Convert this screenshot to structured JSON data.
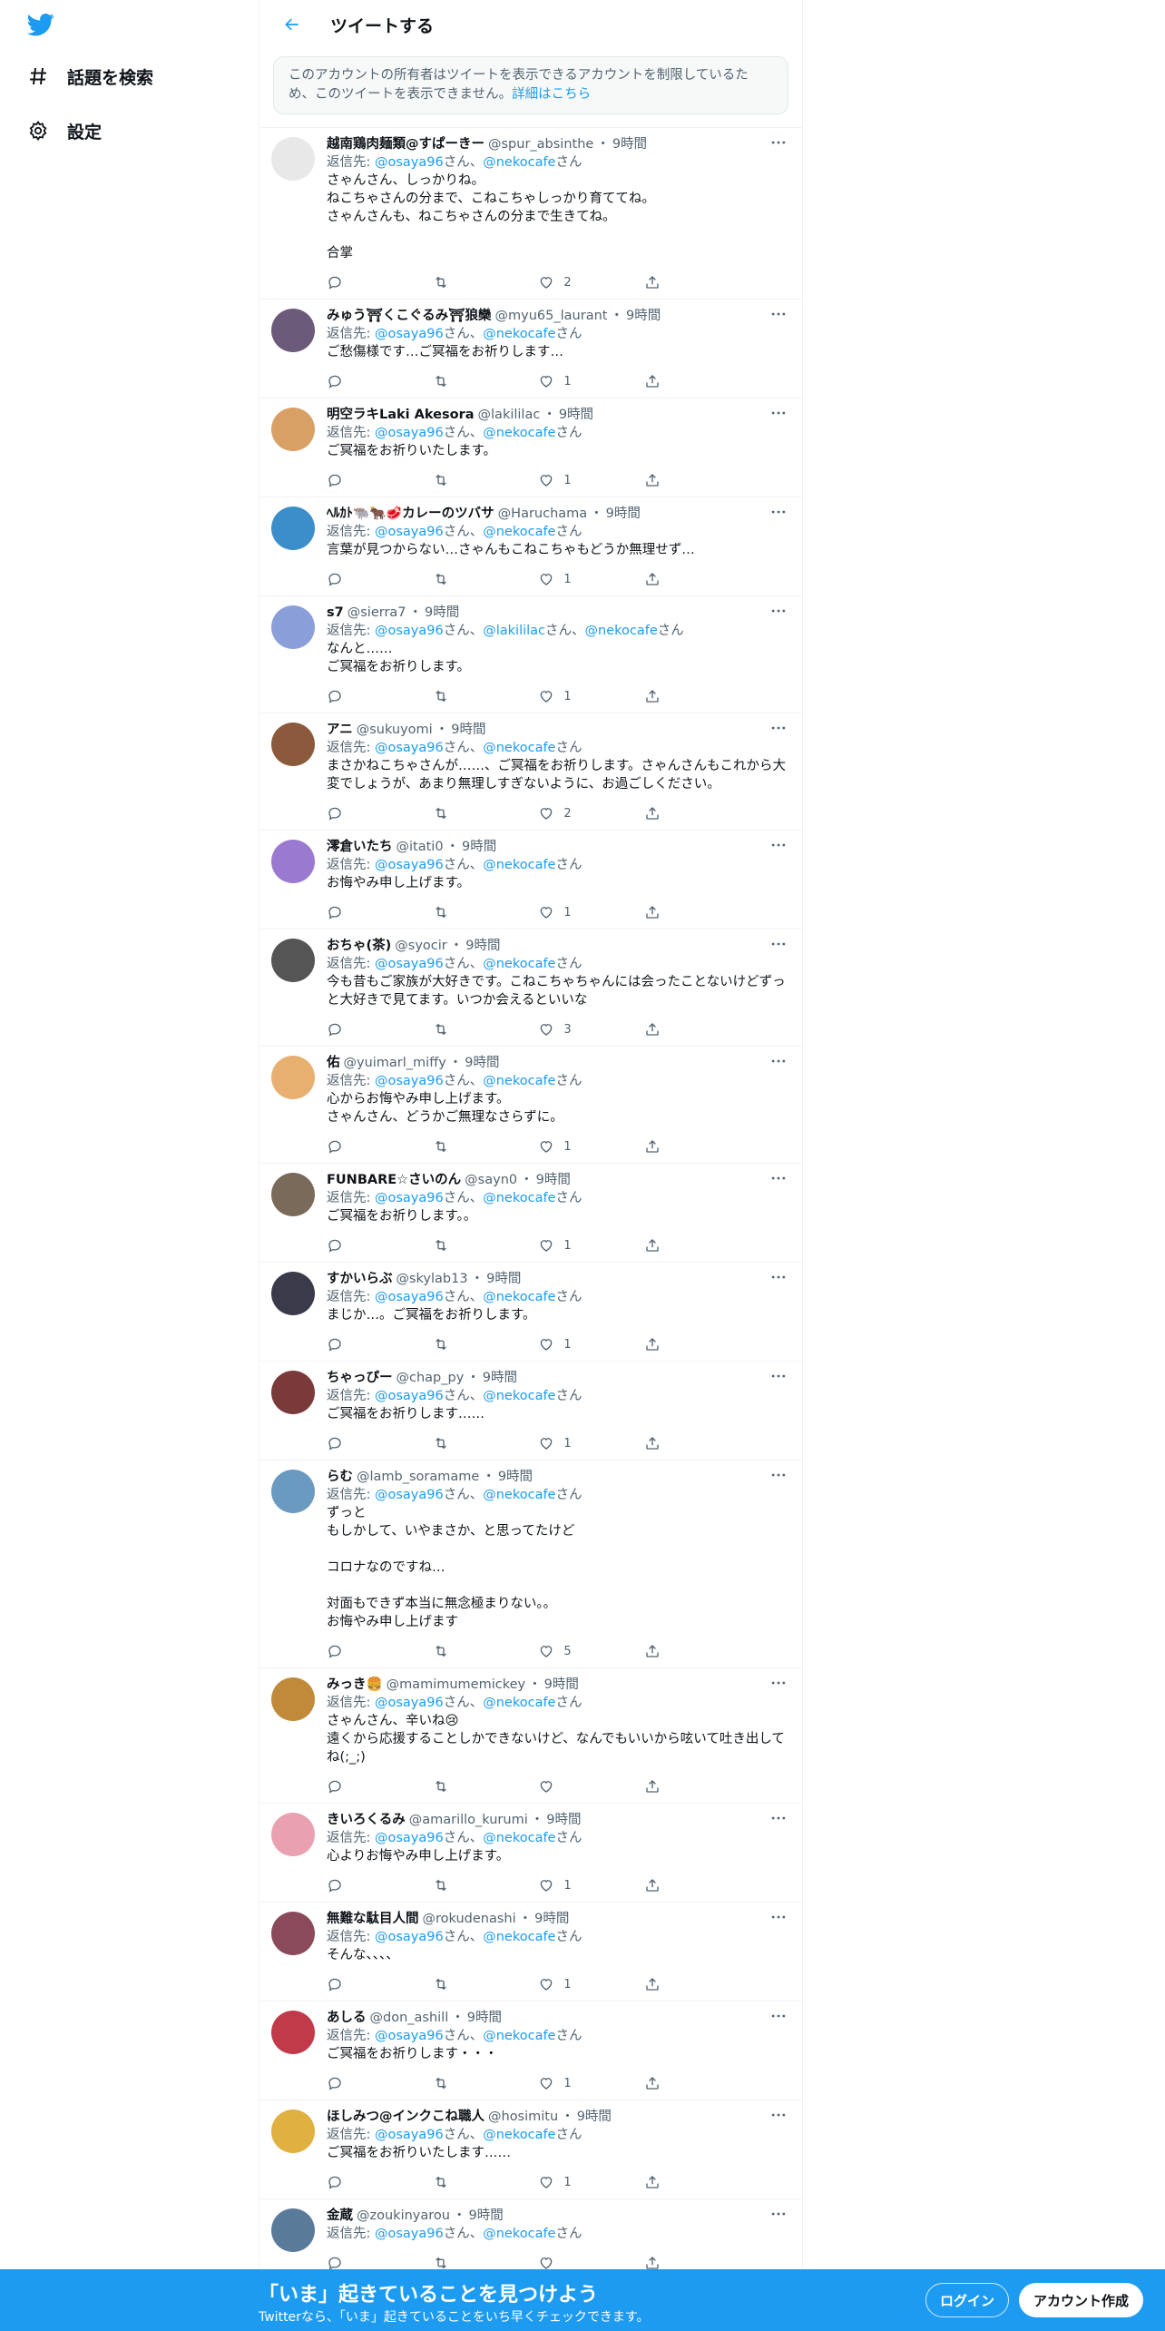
{
  "sidebar": {
    "logo_name": "twitter-logo",
    "items": [
      {
        "label": "話題を検索",
        "icon": "hashtag-icon"
      },
      {
        "label": "設定",
        "icon": "gear-icon"
      }
    ]
  },
  "header": {
    "title": "ツイートする"
  },
  "notice": {
    "text": "このアカウントの所有者はツイートを表示できるアカウントを制限しているため、このツイートを表示できません。",
    "link": "詳細はこちら"
  },
  "labels": {
    "reply_prefix": "返信先: ",
    "san": "さん",
    "sep": "、",
    "dot": "・"
  },
  "colors": {
    "accent": "#1d9bf0",
    "text": "#0f1419",
    "secondary": "#536471"
  },
  "tweets": [
    {
      "name": "越南鶏肉麺類@すぱーきー",
      "handle": "@spur_absinthe",
      "time": "9時間",
      "reply_to": [
        "@osaya96",
        "@nekocafe"
      ],
      "text": "さゃんさん、しっかりね。\nねこちゃさんの分まで、こねこちゃしっかり育ててね。\nさゃんさんも、ねこちゃさんの分まで生きてね。\n\n合掌",
      "likes": "2",
      "avatar_color": "#e8e8e8"
    },
    {
      "name": "みゅう⛩くこぐるみ⛩狼欒",
      "handle": "@myu65_laurant",
      "time": "9時間",
      "reply_to": [
        "@osaya96",
        "@nekocafe"
      ],
      "text": "ご愁傷様です…ご冥福をお祈りします…",
      "likes": "1",
      "avatar_color": "#6b5a7a"
    },
    {
      "name": "明空ラキLaki Akesora",
      "handle": "@lakililac",
      "time": "9時間",
      "reply_to": [
        "@osaya96",
        "@nekocafe"
      ],
      "text": "ご冥福をお祈りいたします。",
      "likes": "1",
      "avatar_color": "#d9a066"
    },
    {
      "name": "ﾍﾙｶﾄ🐃🐂🥩カレーのツバサ",
      "handle": "@Haruchama",
      "time": "9時間",
      "reply_to": [
        "@osaya96",
        "@nekocafe"
      ],
      "text": "言葉が見つからない…さゃんもこねこちゃもどうか無理せず…",
      "likes": "1",
      "avatar_color": "#3b8ec9"
    },
    {
      "name": "s7",
      "handle": "@sierra7",
      "time": "9時間",
      "reply_to": [
        "@osaya96",
        "@lakililac",
        "@nekocafe"
      ],
      "text": "なんと……\nご冥福をお祈りします。",
      "likes": "1",
      "avatar_color": "#8a9ed9"
    },
    {
      "name": "アニ",
      "handle": "@sukuyomi",
      "time": "9時間",
      "reply_to": [
        "@osaya96",
        "@nekocafe"
      ],
      "text": "まさかねこちゃさんが……、ご冥福をお祈りします。さゃんさんもこれから大変でしょうが、あまり無理しすぎないように、お過ごしください。",
      "likes": "2",
      "avatar_color": "#8b5a3c"
    },
    {
      "name": "澪倉いたち",
      "handle": "@itati0",
      "time": "9時間",
      "reply_to": [
        "@osaya96",
        "@nekocafe"
      ],
      "text": "お悔やみ申し上げます。",
      "likes": "1",
      "avatar_color": "#9a7ad0"
    },
    {
      "name": "おちゃ(茶)",
      "handle": "@syocir",
      "time": "9時間",
      "reply_to": [
        "@osaya96",
        "@nekocafe"
      ],
      "text": "今も昔もご家族が大好きです。こねこちゃちゃんには会ったことないけどずっと大好きで見てます。いつか会えるといいな",
      "likes": "3",
      "avatar_color": "#555555"
    },
    {
      "name": "佑",
      "handle": "@yuimarl_miffy",
      "time": "9時間",
      "reply_to": [
        "@osaya96",
        "@nekocafe"
      ],
      "text": "心からお悔やみ申し上げます。\nさゃんさん、どうかご無理なさらずに。",
      "likes": "1",
      "avatar_color": "#e8b070"
    },
    {
      "name": "FUNBARE☆さいのん",
      "handle": "@sayn0",
      "time": "9時間",
      "reply_to": [
        "@osaya96",
        "@nekocafe"
      ],
      "text": "ご冥福をお祈りします。。",
      "likes": "1",
      "avatar_color": "#7a6a5a"
    },
    {
      "name": "すかいらぶ",
      "handle": "@skylab13",
      "time": "9時間",
      "reply_to": [
        "@osaya96",
        "@nekocafe"
      ],
      "text": "まじか…。ご冥福をお祈りします。",
      "likes": "1",
      "avatar_color": "#3a3a4a"
    },
    {
      "name": "ちゃっぴー",
      "handle": "@chap_py",
      "time": "9時間",
      "reply_to": [
        "@osaya96",
        "@nekocafe"
      ],
      "text": "ご冥福をお祈りします……",
      "likes": "1",
      "avatar_color": "#7a3a3a"
    },
    {
      "name": "らむ",
      "handle": "@lamb_soramame",
      "time": "9時間",
      "reply_to": [
        "@osaya96",
        "@nekocafe"
      ],
      "text": "ずっと\nもしかして、いやまさか、と思ってたけど\n\nコロナなのですね…\n\n対面もできず本当に無念極まりない。。\nお悔やみ申し上げます",
      "likes": "5",
      "avatar_color": "#6a9ac0"
    },
    {
      "name": "みっき🍔",
      "handle": "@mamimumemickey",
      "time": "9時間",
      "reply_to": [
        "@osaya96",
        "@nekocafe"
      ],
      "text": "さゃんさん、辛いね😢\n遠くから応援することしかできないけど、なんでもいいから呟いて吐き出してね(;_;)",
      "likes": "",
      "avatar_color": "#c08a3a"
    },
    {
      "name": "きいろくるみ",
      "handle": "@amarillo_kurumi",
      "time": "9時間",
      "reply_to": [
        "@osaya96",
        "@nekocafe"
      ],
      "text": "心よりお悔やみ申し上げます。",
      "likes": "1",
      "avatar_color": "#e9a0b0"
    },
    {
      "name": "無難な駄目人間",
      "handle": "@rokudenashi",
      "time": "9時間",
      "reply_to": [
        "@osaya96",
        "@nekocafe"
      ],
      "text": "そんな、、、、",
      "likes": "1",
      "avatar_color": "#8a4a5a"
    },
    {
      "name": "あしる",
      "handle": "@don_ashill",
      "time": "9時間",
      "reply_to": [
        "@osaya96",
        "@nekocafe"
      ],
      "text": "ご冥福をお祈りします・・・",
      "likes": "1",
      "avatar_color": "#c03a4a"
    },
    {
      "name": "ほしみつ@インクこね職人",
      "handle": "@hosimitu",
      "time": "9時間",
      "reply_to": [
        "@osaya96",
        "@nekocafe"
      ],
      "text": "ご冥福をお祈りいたします……",
      "likes": "1",
      "avatar_color": "#e0b040"
    },
    {
      "name": "金蔵",
      "handle": "@zoukinyarou",
      "time": "9時間",
      "reply_to": [
        "@osaya96",
        "@nekocafe"
      ],
      "text": "",
      "likes": "",
      "avatar_color": "#5a7a9a"
    }
  ],
  "banner": {
    "title": "「いま」起きていることを見つけよう",
    "subtitle": "Twitterなら、「いま」起きていることをいち早くチェックできます。",
    "login": "ログイン",
    "signup": "アカウント作成"
  }
}
